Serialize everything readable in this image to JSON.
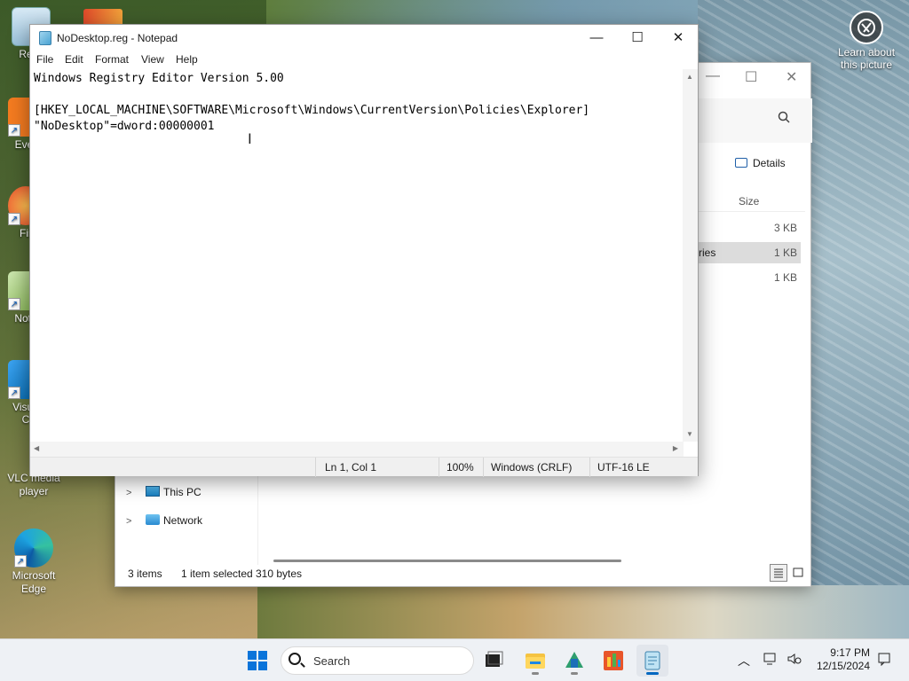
{
  "desktop": {
    "icons": [
      {
        "label": "Recy",
        "name": "recycle-bin"
      },
      {
        "label": "Ever",
        "name": "everything"
      },
      {
        "label": "Fir",
        "name": "firefox"
      },
      {
        "label": "Note",
        "name": "notepad-plus"
      },
      {
        "label": "Visua\nC",
        "name": "visual-studio-code"
      },
      {
        "label": "VLC media player",
        "name": "vlc-media-player"
      },
      {
        "label": "Microsoft Edge",
        "name": "microsoft-edge"
      }
    ],
    "learn_about": "Learn about this picture"
  },
  "explorer": {
    "details_label": "Details",
    "size_header": "Size",
    "rows": [
      {
        "name": "",
        "size": "3 KB",
        "selected": false
      },
      {
        "name": "ntries",
        "size": "1 KB",
        "selected": true
      },
      {
        "name": "",
        "size": "1 KB",
        "selected": false
      }
    ],
    "nav": [
      {
        "label": "This PC"
      },
      {
        "label": "Network"
      }
    ],
    "status": {
      "items": "3 items",
      "selected": "1 item selected",
      "bytes": "310 bytes"
    }
  },
  "notepad": {
    "title": "NoDesktop.reg - Notepad",
    "menu": [
      "File",
      "Edit",
      "Format",
      "View",
      "Help"
    ],
    "lines": [
      "Windows Registry Editor Version 5.00",
      "",
      "[HKEY_LOCAL_MACHINE\\SOFTWARE\\Microsoft\\Windows\\CurrentVersion\\Policies\\Explorer]",
      "\"NoDesktop\"=dword:00000001"
    ],
    "status": {
      "position": "Ln 1, Col 1",
      "zoom": "100%",
      "line_endings": "Windows (CRLF)",
      "encoding": "UTF-16 LE"
    }
  },
  "taskbar": {
    "search_label": "Search",
    "time": "9:17 PM",
    "date": "12/15/2024"
  },
  "colors": {
    "accent": "#0067c0",
    "taskbar_bg": "#eef1f5"
  }
}
